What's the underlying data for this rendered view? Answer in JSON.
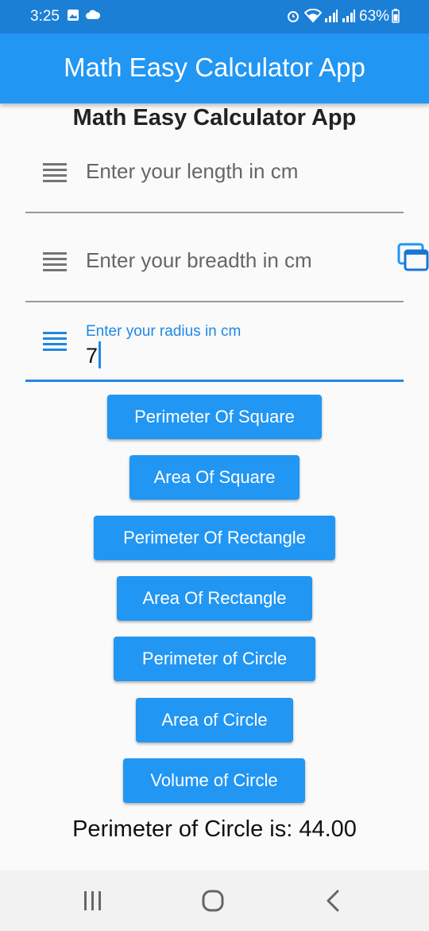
{
  "status_bar": {
    "time": "3:25",
    "battery": "63%",
    "icons": [
      "image-icon",
      "cloud-icon",
      "alarm-icon",
      "wifi-icon",
      "signal-icon",
      "signal-icon",
      "battery-icon"
    ]
  },
  "app_bar": {
    "title": "Math Easy Calculator App"
  },
  "page": {
    "heading": "Math Easy Calculator App"
  },
  "fields": {
    "length": {
      "placeholder": "Enter your length in cm",
      "icon": "list-icon"
    },
    "breadth": {
      "placeholder": "Enter your breadth in cm",
      "icon": "list-icon"
    },
    "radius": {
      "label": "Enter your radius in cm",
      "value": "7",
      "icon": "list-icon"
    }
  },
  "buttons": {
    "perimeter_square": "Perimeter Of Square",
    "area_square": "Area Of Square",
    "perimeter_rectangle": "Perimeter Of Rectangle",
    "area_rectangle": "Area Of Rectangle",
    "perimeter_circle": "Perimeter of Circle",
    "area_circle": "Area of Circle",
    "volume_circle": "Volume of Circle"
  },
  "result": {
    "text": "Perimeter of Circle is: 44.00"
  },
  "colors": {
    "primary": "#2196f3",
    "status_bar": "#1c7fd6",
    "focus": "#1e88e5"
  },
  "nav": {
    "icons": [
      "recent-apps-icon",
      "home-icon",
      "back-icon"
    ]
  }
}
